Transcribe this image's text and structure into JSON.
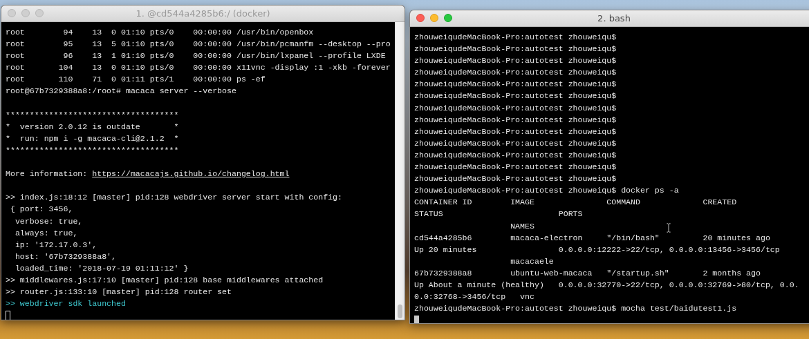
{
  "windows": [
    {
      "title": "1. @cd544a4285b6:/ (docker)",
      "active": false,
      "lines": [
        {
          "kind": "text",
          "text": "root        94    13  0 01:10 pts/0    00:00:00 /usr/bin/openbox"
        },
        {
          "kind": "text",
          "text": "root        95    13  5 01:10 pts/0    00:00:00 /usr/bin/pcmanfm --desktop --pro"
        },
        {
          "kind": "text",
          "text": "root        96    13  1 01:10 pts/0    00:00:00 /usr/bin/lxpanel --profile LXDE"
        },
        {
          "kind": "text",
          "text": "root       104    13  0 01:10 pts/0    00:00:00 x11vnc -display :1 -xkb -forever"
        },
        {
          "kind": "text",
          "text": "root       110    71  0 01:11 pts/1    00:00:00 ps -ef"
        },
        {
          "kind": "text",
          "text": "root@67b7329388a8:/root# macaca server --verbose"
        },
        {
          "kind": "blank"
        },
        {
          "kind": "text",
          "text": "************************************"
        },
        {
          "kind": "text",
          "text": "*  version 2.0.12 is outdate       *"
        },
        {
          "kind": "text",
          "text": "*  run: npm i -g macaca-cli@2.1.2  *"
        },
        {
          "kind": "text",
          "text": "************************************"
        },
        {
          "kind": "blank"
        },
        {
          "kind": "link",
          "text": "More information: ",
          "link": "https://macacajs.github.io/changelog.html"
        },
        {
          "kind": "blank"
        },
        {
          "kind": "text",
          "text": ">> index.js:18:12 [master] pid:128 webdriver server start with config:"
        },
        {
          "kind": "text",
          "text": " { port: 3456,"
        },
        {
          "kind": "text",
          "text": "  verbose: true,"
        },
        {
          "kind": "text",
          "text": "  always: true,"
        },
        {
          "kind": "text",
          "text": "  ip: '172.17.0.3',"
        },
        {
          "kind": "text",
          "text": "  host: '67b7329388a8',"
        },
        {
          "kind": "text",
          "text": "  loaded_time: '2018-07-19 01:11:12' }"
        },
        {
          "kind": "text",
          "text": ">> middlewares.js:17:10 [master] pid:128 base middlewares attached"
        },
        {
          "kind": "text",
          "text": ">> router.js:133:10 [master] pid:128 router set"
        },
        {
          "kind": "highlight",
          "text": ">> webdriver sdk launched"
        }
      ]
    },
    {
      "title": "2. bash",
      "active": true,
      "lines": [
        {
          "kind": "text",
          "text": "zhouweiqudeMacBook-Pro:autotest zhouweiqu$"
        },
        {
          "kind": "text",
          "text": "zhouweiqudeMacBook-Pro:autotest zhouweiqu$"
        },
        {
          "kind": "text",
          "text": "zhouweiqudeMacBook-Pro:autotest zhouweiqu$"
        },
        {
          "kind": "text",
          "text": "zhouweiqudeMacBook-Pro:autotest zhouweiqu$"
        },
        {
          "kind": "text",
          "text": "zhouweiqudeMacBook-Pro:autotest zhouweiqu$"
        },
        {
          "kind": "text",
          "text": "zhouweiqudeMacBook-Pro:autotest zhouweiqu$"
        },
        {
          "kind": "text",
          "text": "zhouweiqudeMacBook-Pro:autotest zhouweiqu$"
        },
        {
          "kind": "text",
          "text": "zhouweiqudeMacBook-Pro:autotest zhouweiqu$"
        },
        {
          "kind": "text",
          "text": "zhouweiqudeMacBook-Pro:autotest zhouweiqu$"
        },
        {
          "kind": "text",
          "text": "zhouweiqudeMacBook-Pro:autotest zhouweiqu$"
        },
        {
          "kind": "text",
          "text": "zhouweiqudeMacBook-Pro:autotest zhouweiqu$"
        },
        {
          "kind": "text",
          "text": "zhouweiqudeMacBook-Pro:autotest zhouweiqu$"
        },
        {
          "kind": "text",
          "text": "zhouweiqudeMacBook-Pro:autotest zhouweiqu$"
        },
        {
          "kind": "text",
          "text": "zhouweiqudeMacBook-Pro:autotest zhouweiqu$ docker ps -a"
        },
        {
          "kind": "text",
          "text": "CONTAINER ID        IMAGE               COMMAND             CREATED"
        },
        {
          "kind": "text",
          "text": "STATUS                        PORTS"
        },
        {
          "kind": "text",
          "text": "                    NAMES"
        },
        {
          "kind": "text",
          "text": "cd544a4285b6        macaca-electron     \"/bin/bash\"         20 minutes ago"
        },
        {
          "kind": "text",
          "text": "Up 20 minutes                 0.0.0.0:12222->22/tcp, 0.0.0.0:13456->3456/tcp"
        },
        {
          "kind": "text",
          "text": "                    macacaele"
        },
        {
          "kind": "text",
          "text": "67b7329388a8        ubuntu-web-macaca   \"/startup.sh\"       2 months ago"
        },
        {
          "kind": "text",
          "text": "Up About a minute (healthy)   0.0.0.0:32770->22/tcp, 0.0.0.0:32769->80/tcp, 0.0."
        },
        {
          "kind": "text",
          "text": "0.0:32768->3456/tcp   vnc"
        },
        {
          "kind": "text",
          "text": "zhouweiqudeMacBook-Pro:autotest zhouweiqu$ mocha test/baidutest1.js"
        }
      ]
    }
  ]
}
